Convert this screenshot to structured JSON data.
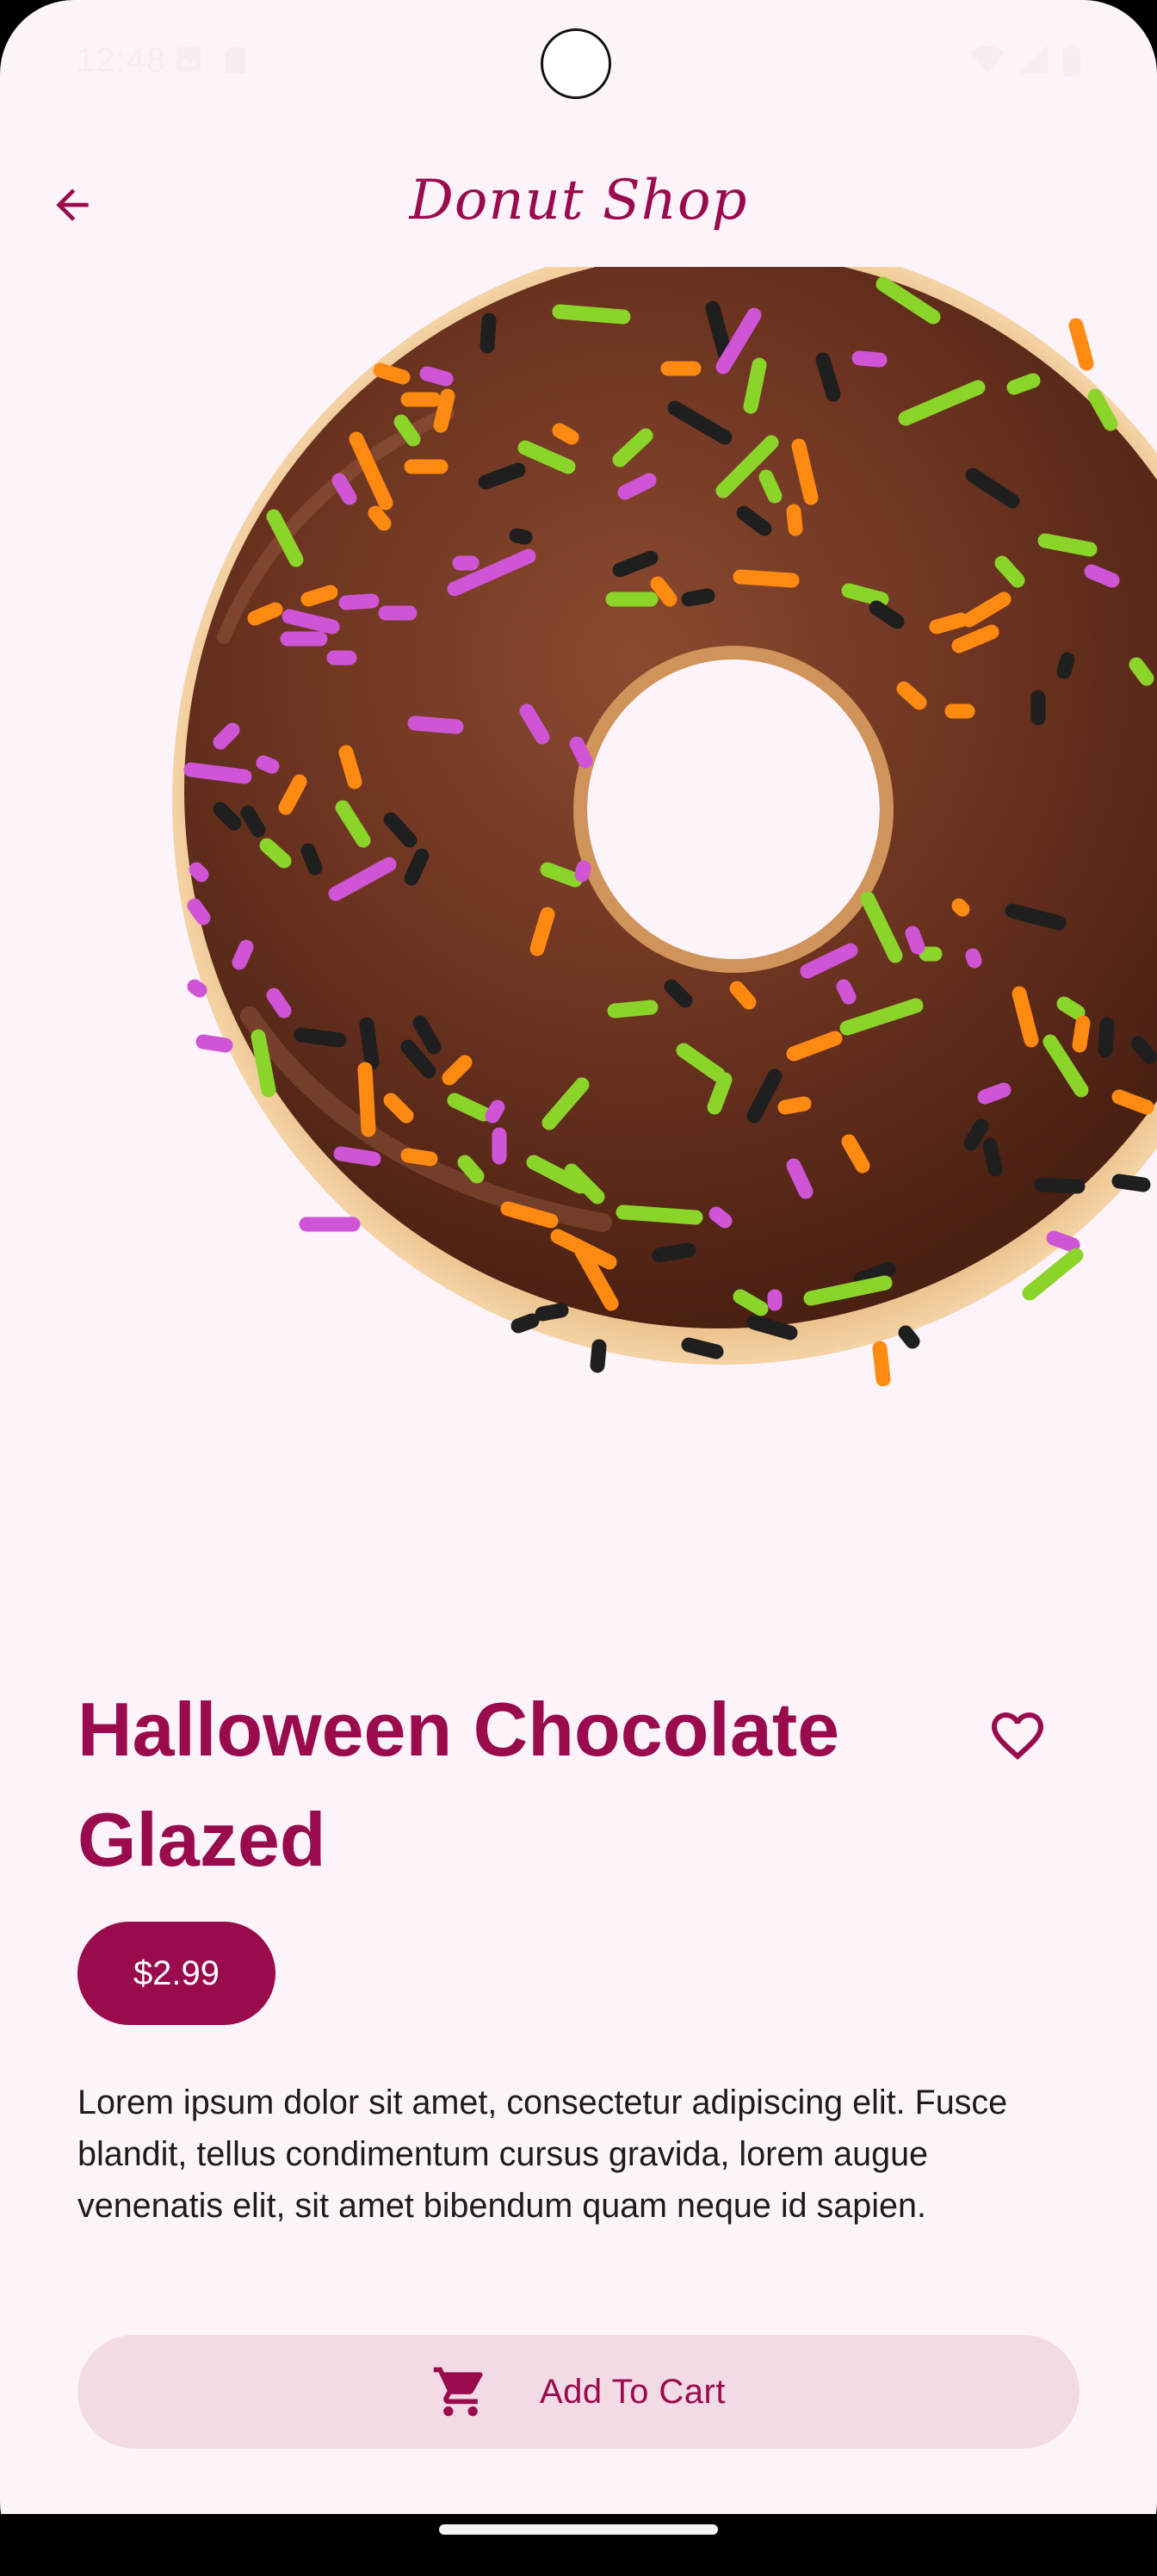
{
  "status_bar": {
    "time": "12:48",
    "left_icons": [
      "image-notification-icon",
      "sim-card-icon"
    ],
    "right_icons": [
      "wifi-icon",
      "cellular-signal-icon",
      "battery-icon"
    ]
  },
  "app_bar": {
    "back_icon": "arrow-back-icon",
    "title": "Donut Shop"
  },
  "product": {
    "image": "chocolate-glazed-donut-with-sprinkles",
    "title": "Halloween Chocolate Glazed",
    "favorite_icon": "heart-outline-icon",
    "price": "$2.99",
    "description": "Lorem ipsum dolor sit amet, consectetur adipiscing elit. Fusce blandit, tellus condimentum cursus gravida, lorem augue venenatis elit, sit amet bibendum quam neque id sapien."
  },
  "actions": {
    "cart_icon": "shopping-cart-icon",
    "add_to_cart_label": "Add To Cart"
  },
  "colors": {
    "background": "#fdf4fb",
    "primary": "#9a0b4d",
    "button_tint": "#f2dae6",
    "chocolate": "#5a2a1a",
    "sprinkle_green": "#8bd42a",
    "sprinkle_orange": "#ff8a12",
    "sprinkle_purple": "#cf55d6",
    "sprinkle_black": "#1f1f1f"
  }
}
